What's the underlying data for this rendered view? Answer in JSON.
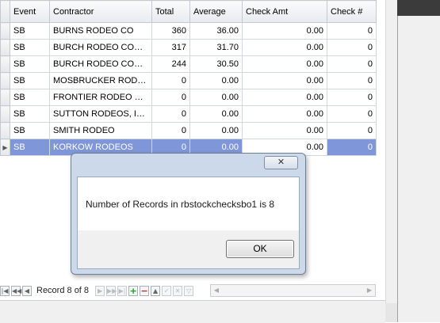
{
  "grid": {
    "columns": [
      "Event",
      "Contractor",
      "Total",
      "Average",
      "Check Amt",
      "Check #"
    ],
    "rows": [
      {
        "event": "SB",
        "contractor": "BURNS RODEO CO",
        "total": "360",
        "average": "36.00",
        "check_amt": "0.00",
        "check_no": "0"
      },
      {
        "event": "SB",
        "contractor": "BURCH RODEO COMP...",
        "total": "317",
        "average": "31.70",
        "check_amt": "0.00",
        "check_no": "0"
      },
      {
        "event": "SB",
        "contractor": "BURCH RODEO COMP...",
        "total": "244",
        "average": "30.50",
        "check_amt": "0.00",
        "check_no": "0"
      },
      {
        "event": "SB",
        "contractor": "MOSBRUCKER RODEO...",
        "total": "0",
        "average": "0.00",
        "check_amt": "0.00",
        "check_no": "0"
      },
      {
        "event": "SB",
        "contractor": "FRONTIER RODEO CO...",
        "total": "0",
        "average": "0.00",
        "check_amt": "0.00",
        "check_no": "0"
      },
      {
        "event": "SB",
        "contractor": "SUTTON RODEOS, INC.",
        "total": "0",
        "average": "0.00",
        "check_amt": "0.00",
        "check_no": "0"
      },
      {
        "event": "SB",
        "contractor": "SMITH RODEO",
        "total": "0",
        "average": "0.00",
        "check_amt": "0.00",
        "check_no": "0"
      },
      {
        "event": "SB",
        "contractor": "KORKOW RODEOS",
        "total": "0",
        "average": "0.00",
        "check_amt": "0.00",
        "check_no": "0"
      }
    ],
    "selected_row_index": 7
  },
  "navigator": {
    "record_text": "Record 8 of 8",
    "icons": [
      "first-page-icon",
      "prev-page-icon",
      "prev-record-icon",
      "next-record-icon",
      "next-page-icon",
      "last-page-icon",
      "add-icon",
      "delete-icon",
      "edit-icon",
      "post-icon",
      "cancel-icon",
      "filter-icon"
    ]
  },
  "dialog": {
    "close_glyph": "✕",
    "message": "Number of Records in rbstockchecksbo1 is 8",
    "ok_label": "OK"
  },
  "colors": {
    "selection": "#7f96d8",
    "dialog_frame": "#cbd9eb",
    "add_icon": "#1f9a1f",
    "delete_icon": "#d02020"
  }
}
